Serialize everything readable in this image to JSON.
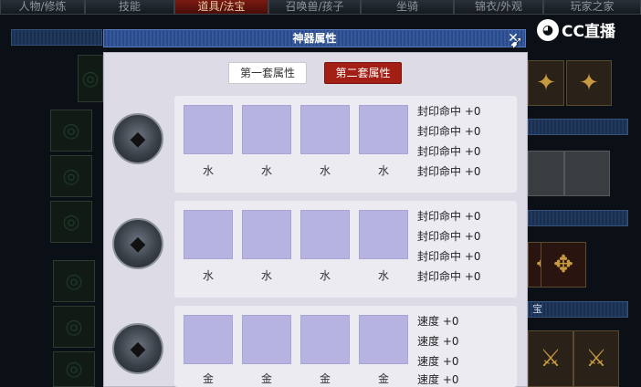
{
  "top_tabs": [
    {
      "label": "人物/修炼",
      "active": false
    },
    {
      "label": "技能",
      "active": false
    },
    {
      "label": "道具/法宝",
      "active": true
    },
    {
      "label": "召唤兽/孩子",
      "active": false
    },
    {
      "label": "坐骑",
      "active": false
    },
    {
      "label": "锦衣/外观",
      "active": false
    },
    {
      "label": "玩家之家",
      "active": false
    }
  ],
  "background": {
    "side_strip_label": "宝"
  },
  "logo": {
    "mark": "◕",
    "text": "CC直播"
  },
  "dialog": {
    "title": "神器属性",
    "close_glyph": "✕",
    "tabs": [
      {
        "label": "第一套属性",
        "active": false
      },
      {
        "label": "第二套属性",
        "active": true
      }
    ],
    "sets": [
      {
        "icon": "helmet-icon",
        "slots": [
          "水",
          "水",
          "水",
          "水"
        ],
        "stats": [
          "封印命中 +0",
          "封印命中 +0",
          "封印命中 +0",
          "封印命中 +0"
        ]
      },
      {
        "icon": "armor-icon",
        "slots": [
          "水",
          "水",
          "水",
          "水"
        ],
        "stats": [
          "封印命中 +0",
          "封印命中 +0",
          "封印命中 +0",
          "封印命中 +0"
        ]
      },
      {
        "icon": "boot-icon",
        "slots": [
          "金",
          "金",
          "金",
          "金"
        ],
        "stats": [
          "速度 +0",
          "速度 +0",
          "速度 +0",
          "速度 +0"
        ]
      }
    ]
  },
  "colors": {
    "accent_red": "#a31e14",
    "slot_purple": "#b7b3e0",
    "title_blue": "#35599c"
  }
}
